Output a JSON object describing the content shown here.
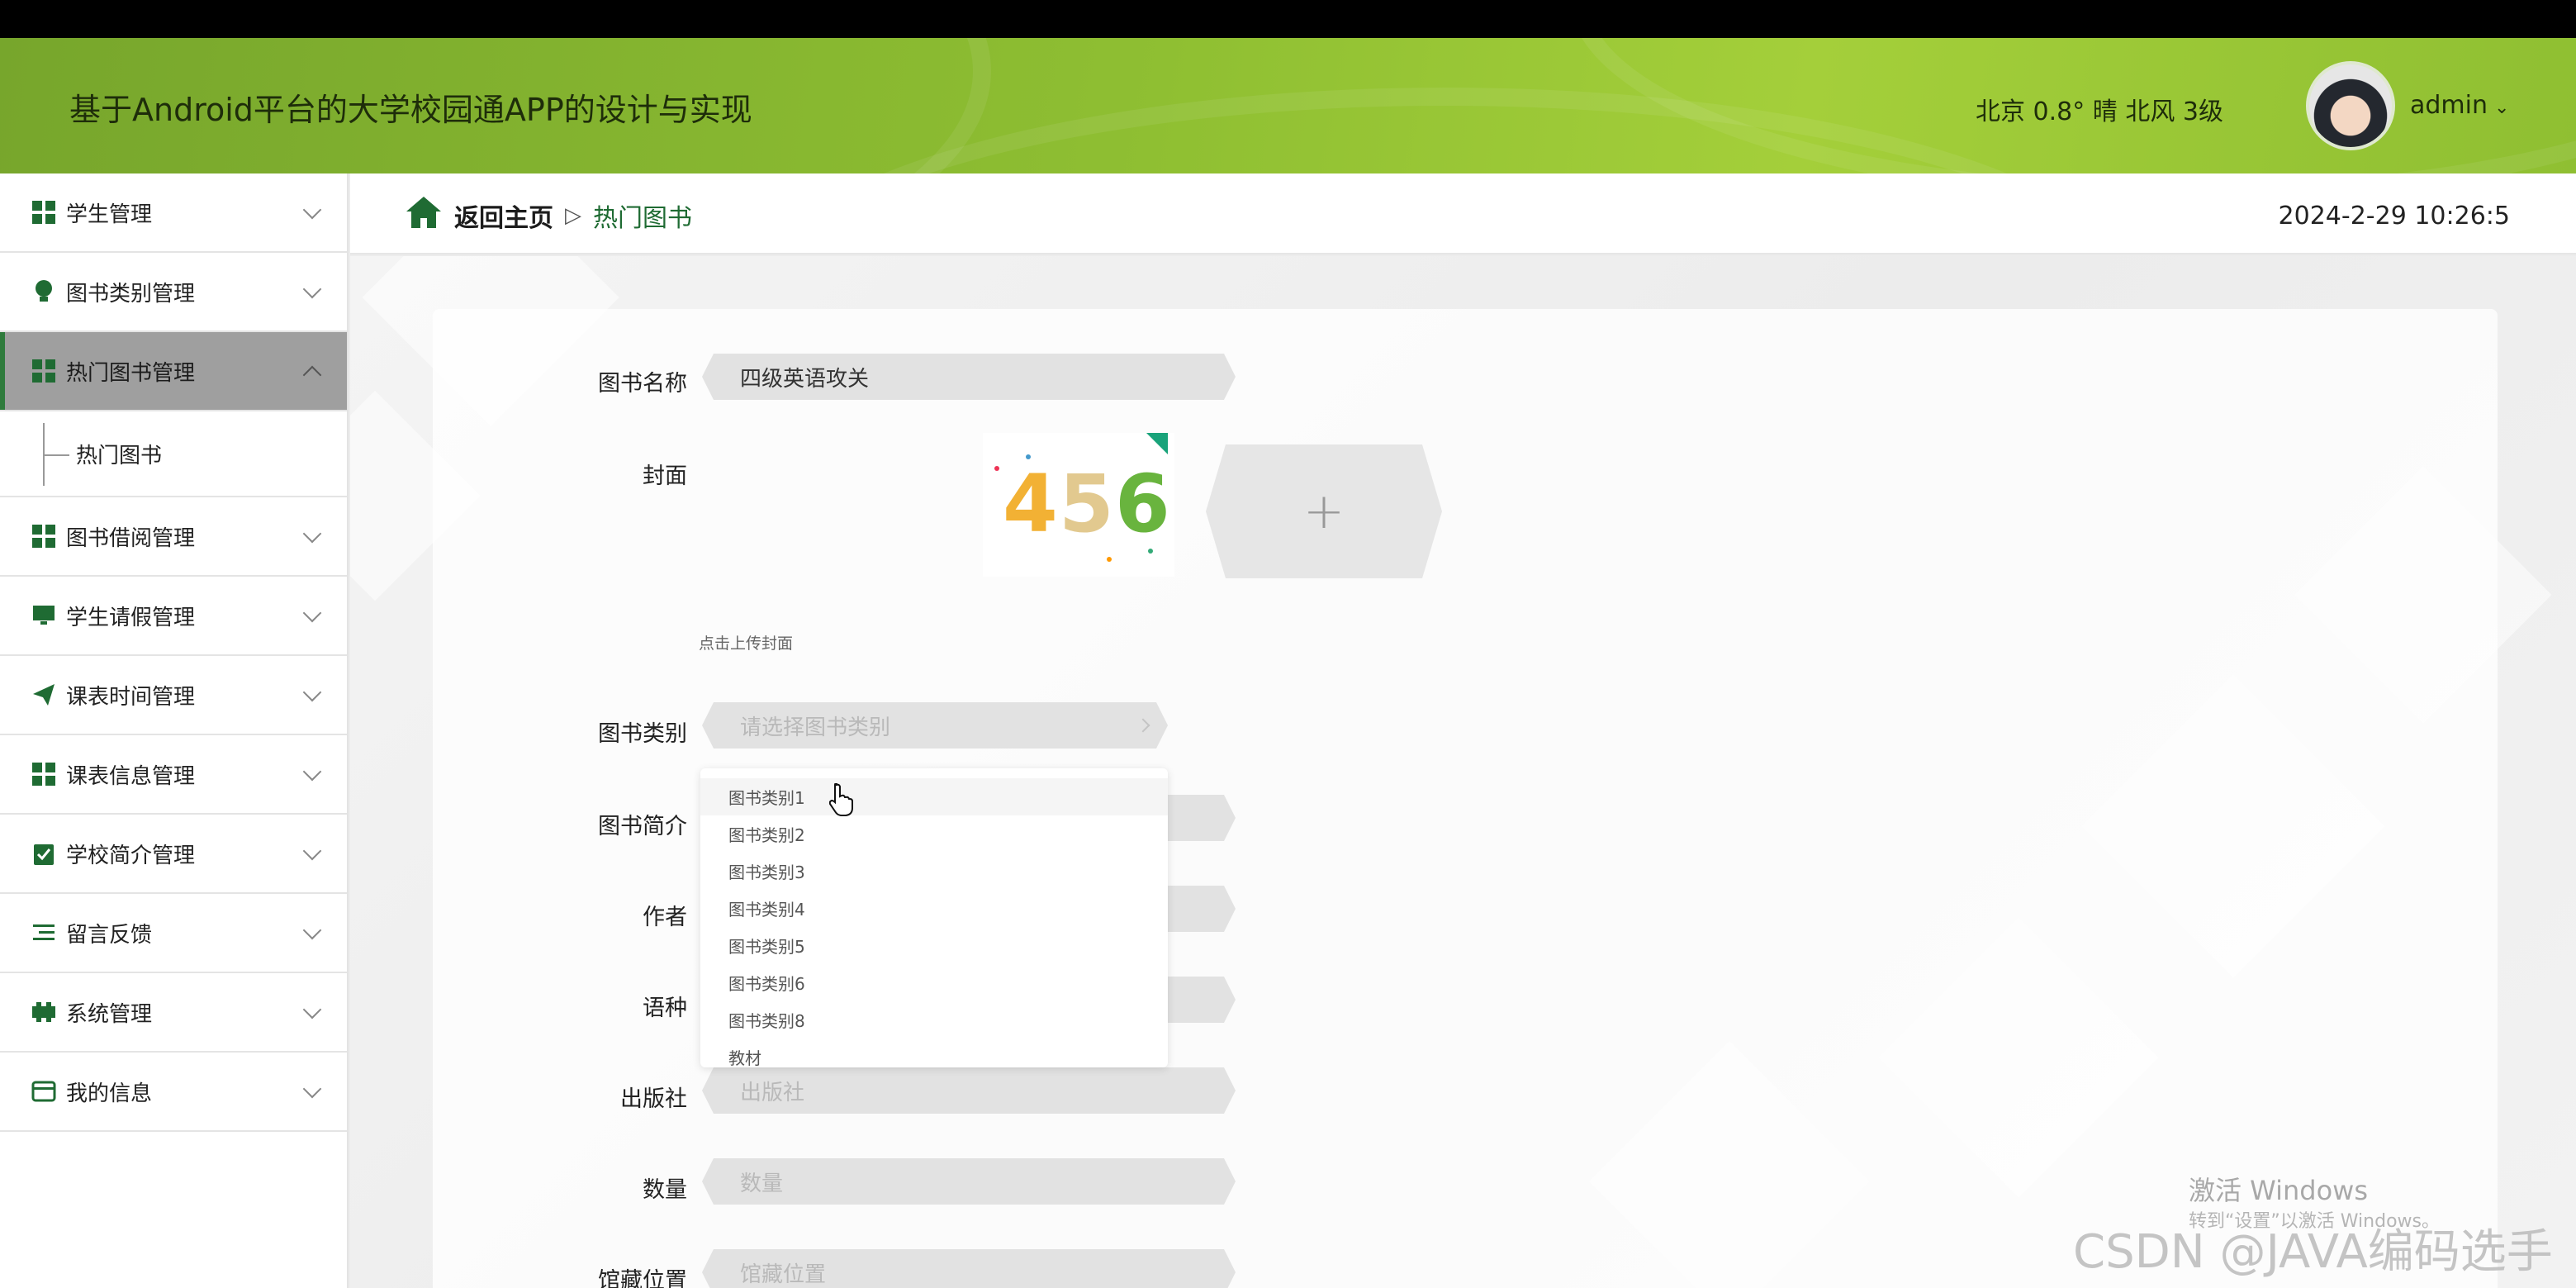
{
  "header": {
    "title": "基于Android平台的大学校园通APP的设计与实现",
    "weather": "北京 0.8° 晴 北风 3级",
    "username": "admin"
  },
  "sidebar": {
    "items": [
      {
        "label": "学生管理",
        "icon": "grid-icon"
      },
      {
        "label": "图书类别管理",
        "icon": "lightbulb-icon"
      },
      {
        "label": "热门图书管理",
        "icon": "grid-icon",
        "active": true
      },
      {
        "label": "图书借阅管理",
        "icon": "grid-icon"
      },
      {
        "label": "学生请假管理",
        "icon": "monitor-icon"
      },
      {
        "label": "课表时间管理",
        "icon": "paper-plane-icon"
      },
      {
        "label": "课表信息管理",
        "icon": "grid-icon"
      },
      {
        "label": "学校简介管理",
        "icon": "clipboard-check-icon"
      },
      {
        "label": "留言反馈",
        "icon": "list-icon"
      },
      {
        "label": "系统管理",
        "icon": "tool-icon"
      },
      {
        "label": "我的信息",
        "icon": "card-icon"
      }
    ],
    "subitem": "热门图书"
  },
  "breadcrumb": {
    "home": "返回主页",
    "separator": "▷",
    "current": "热门图书"
  },
  "datetime": "2024-2-29 10:26:5",
  "form": {
    "book_name_label": "图书名称",
    "book_name_value": "四级英语攻关",
    "cover_label": "封面",
    "cover_digits": [
      "4",
      "5",
      "6"
    ],
    "upload_plus": "+",
    "upload_hint": "点击上传封面",
    "category_label": "图书类别",
    "category_placeholder": "请选择图书类别",
    "intro_label": "图书简介",
    "author_label": "作者",
    "language_label": "语种",
    "publisher_label": "出版社",
    "publisher_placeholder": "出版社",
    "quantity_label": "数量",
    "quantity_placeholder": "数量",
    "location_label": "馆藏位置",
    "location_placeholder": "馆藏位置"
  },
  "dropdown": {
    "options": [
      "图书类别1",
      "图书类别2",
      "图书类别3",
      "图书类别4",
      "图书类别5",
      "图书类别6",
      "图书类别8",
      "教材"
    ]
  },
  "watermarks": {
    "activate_title": "激活 Windows",
    "activate_sub": "转到“设置”以激活 Windows。",
    "csdn": "CSDN @JAVA编码选手"
  },
  "colors": {
    "header_green": "#8fbf32",
    "accent_green": "#1f6b33",
    "active_menu_bg": "#9f9f9f"
  }
}
